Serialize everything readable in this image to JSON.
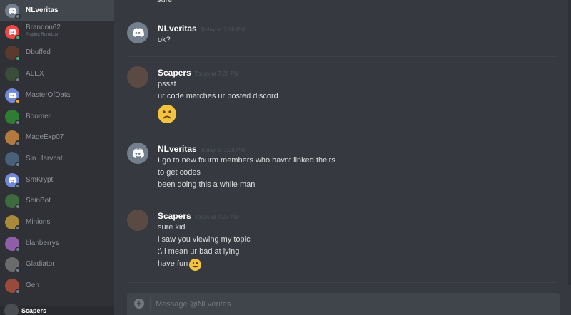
{
  "colors": {
    "online": "#43b581",
    "idle": "#faa61a",
    "dnd": "#f04747",
    "offline": "#747f8d",
    "blurple": "#7289da"
  },
  "dms": [
    {
      "name": "NLveritas",
      "active": true,
      "avatar": "discord",
      "avatar_color": "#747f8d",
      "status": "offline"
    },
    {
      "name": "Brandon62",
      "sub": "Playing RuneLite",
      "avatar": "discord",
      "avatar_color": "#f04747",
      "status": "online"
    },
    {
      "name": "Dbuffed",
      "avatar": "photo",
      "avatar_color": "#5a3a2e",
      "status": "online"
    },
    {
      "name": "ALEX",
      "avatar": "photo",
      "avatar_color": "#3a4c3a",
      "status": "offline"
    },
    {
      "name": "MasterOfData",
      "avatar": "discord",
      "avatar_color": "#7289da",
      "status": "idle"
    },
    {
      "name": "Boomer",
      "avatar": "photo",
      "avatar_color": "#2e7d32",
      "status": "offline"
    },
    {
      "name": "MageExp07",
      "avatar": "photo",
      "avatar_color": "#b37a3f",
      "status": "offline"
    },
    {
      "name": "Sin Harvest",
      "avatar": "photo",
      "avatar_color": "#4a5f7a",
      "status": "offline"
    },
    {
      "name": "SmKrypt",
      "avatar": "discord",
      "avatar_color": "#7289da",
      "status": "offline"
    },
    {
      "name": "ShinBot",
      "avatar": "photo",
      "avatar_color": "#3d6b3d",
      "status": "offline"
    },
    {
      "name": "Minions",
      "avatar": "photo",
      "avatar_color": "#a88a3a",
      "status": "offline"
    },
    {
      "name": "blahberrys",
      "avatar": "photo",
      "avatar_color": "#8e5fa8",
      "status": "offline"
    },
    {
      "name": "Gladiator",
      "avatar": "photo",
      "avatar_color": "#6b6b6b",
      "status": "offline"
    },
    {
      "name": "Gen",
      "avatar": "photo",
      "avatar_color": "#9a4a3a",
      "status": "offline"
    }
  ],
  "current_user": {
    "name": "Scapers"
  },
  "top_clipped_text": "sure",
  "messages": [
    {
      "author": "NLveritas",
      "time": "Today at 7:26 PM",
      "avatar": "discord",
      "lines": [
        "ok?"
      ]
    },
    {
      "author": "Scapers",
      "time": "Today at 7:26 PM",
      "avatar": "photo",
      "lines": [
        "pssst",
        "ur code matches ur posted discord"
      ],
      "emoji": "frowning-face"
    },
    {
      "author": "NLveritas",
      "time": "Today at 7:26 PM",
      "avatar": "discord",
      "lines": [
        "I go to new fourm members who havnt linked theirs",
        "to get codes",
        "been doing this  a while man"
      ]
    },
    {
      "author": "Scapers",
      "time": "Today at 7:27 PM",
      "avatar": "photo",
      "lines": [
        "sure kid",
        "i saw you viewing my topic",
        ":\\ i mean ur bad at lying",
        "have fun"
      ],
      "emoji": "smiling-face"
    }
  ],
  "composer": {
    "placeholder": "Message @NLveritas",
    "add_label": "+"
  }
}
